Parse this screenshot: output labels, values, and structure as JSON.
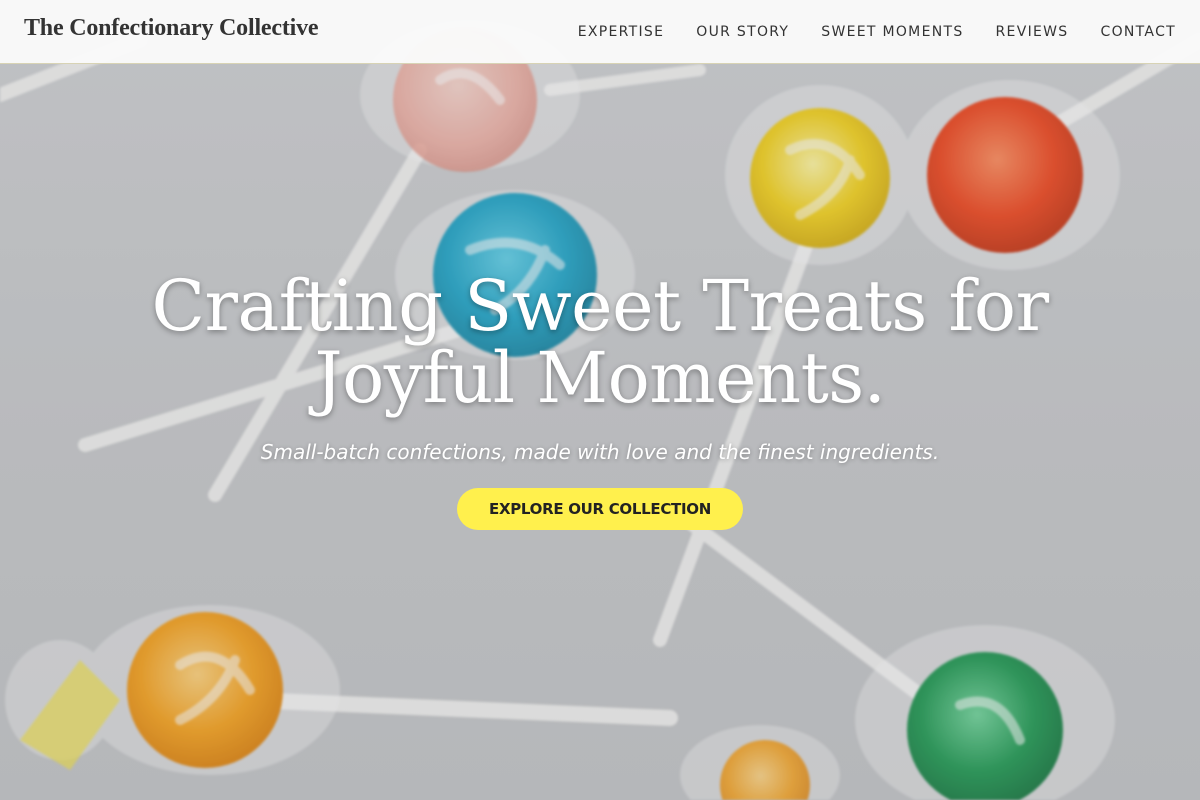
{
  "site": {
    "brand": "The Confectionary Collective"
  },
  "nav": {
    "items": [
      {
        "label": "EXPERTISE"
      },
      {
        "label": "OUR STORY"
      },
      {
        "label": "SWEET MOMENTS"
      },
      {
        "label": "REVIEWS"
      },
      {
        "label": "CONTACT"
      }
    ]
  },
  "hero": {
    "title": "Crafting Sweet Treats for Joyful Moments.",
    "subtitle": "Small-batch confections, made with love and the finest ingredients.",
    "cta_label": "EXPLORE OUR COLLECTION",
    "background_image": "lollipops-hero-image"
  },
  "colors": {
    "accent": "#fff04d",
    "nav_text": "#333333",
    "hero_text": "#ffffff"
  }
}
